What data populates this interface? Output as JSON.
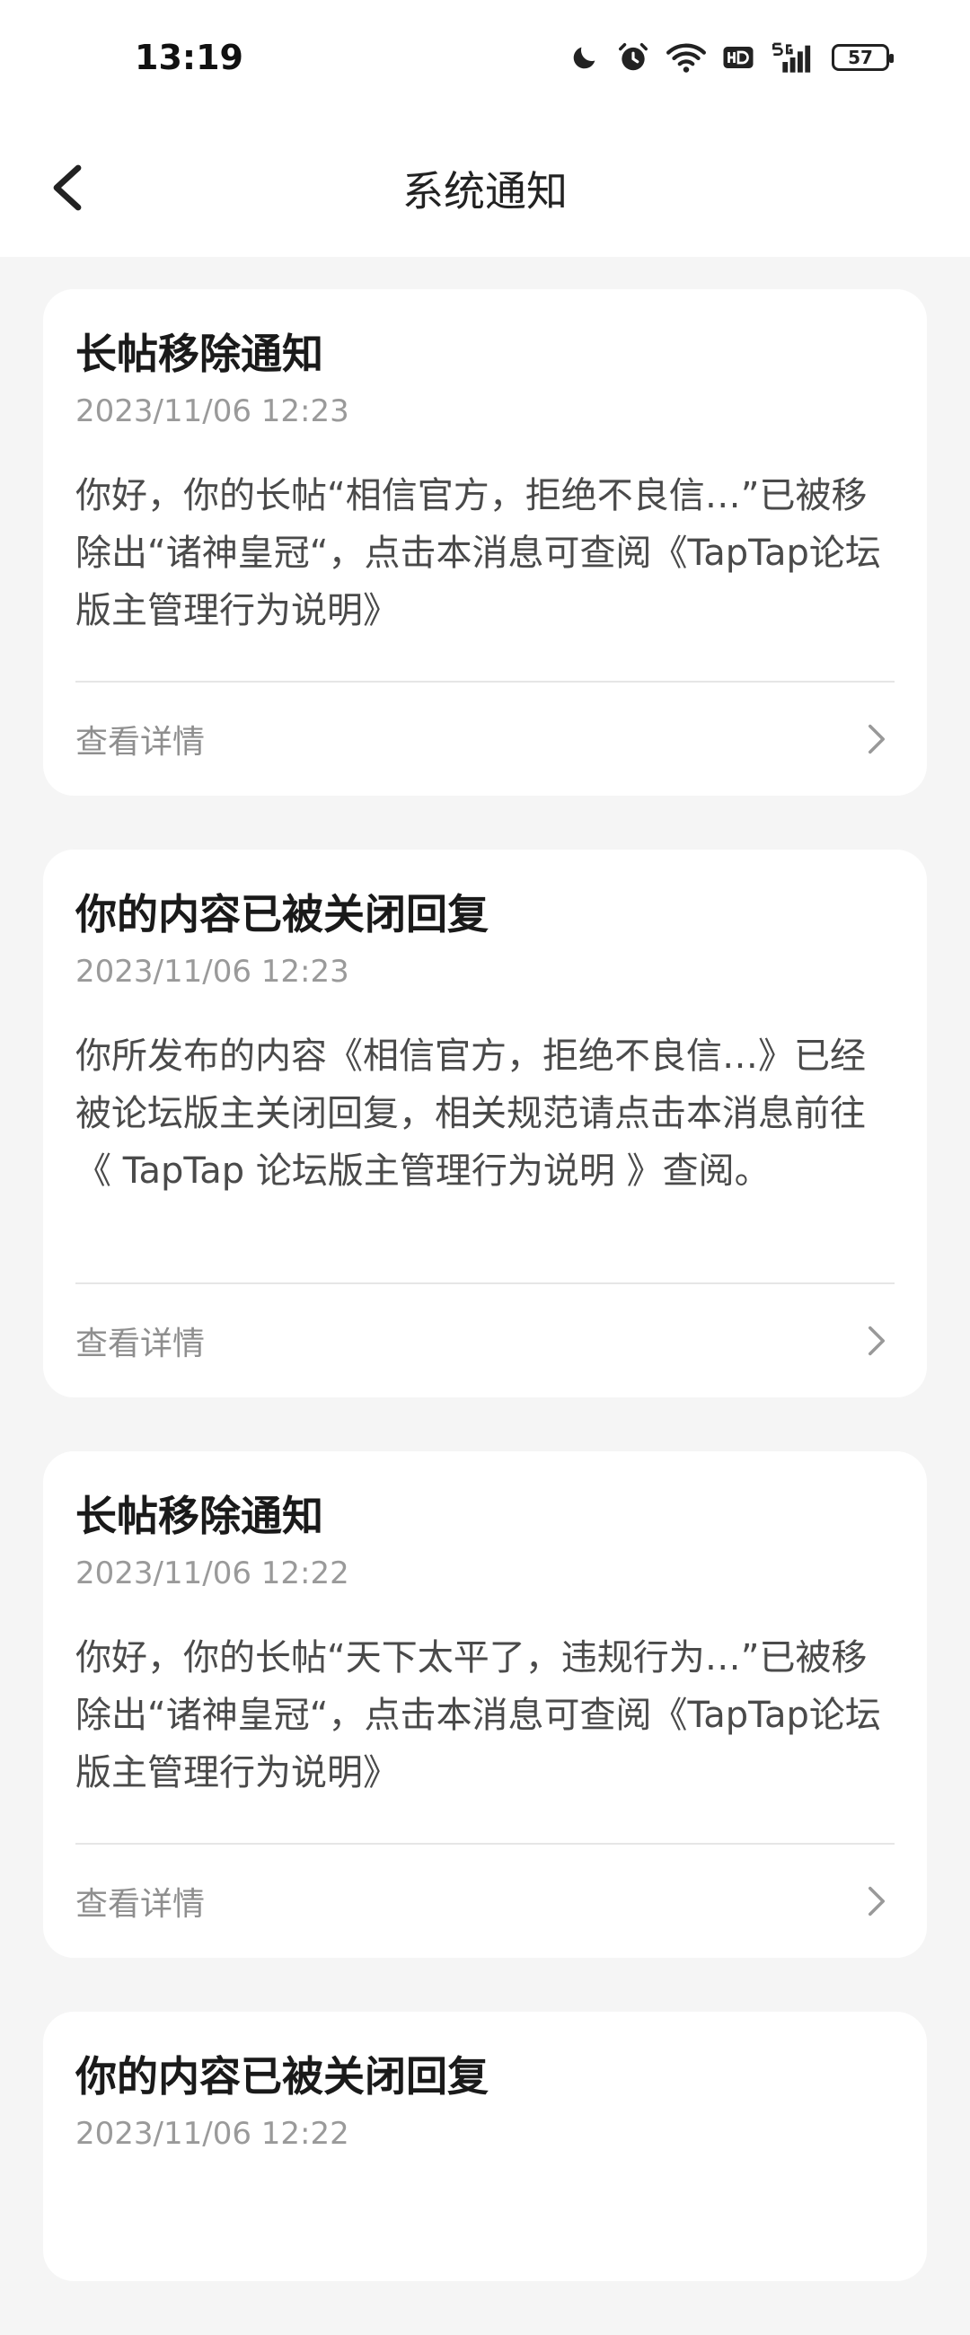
{
  "status_bar": {
    "time": "13:19",
    "battery_level": "57",
    "icons": [
      "moon-icon",
      "alarm-icon",
      "wifi-icon",
      "hd-icon",
      "signal-5g-icon",
      "battery-icon"
    ]
  },
  "header": {
    "title": "系统通知",
    "back_icon": "chevron-left-icon"
  },
  "cards": [
    {
      "title": "长帖移除通知",
      "time": "2023/11/06 12:23",
      "body": "你好，你的长帖“相信官方，拒绝不良信…”已被移除出“诸神皇冠“，点击本消息可查阅《TapTap论坛版主管理行为说明》",
      "detail_label": "查看详情"
    },
    {
      "title": "你的内容已被关闭回复",
      "time": "2023/11/06 12:23",
      "body": "你所发布的内容《相信官方，拒绝不良信…》已经被论坛版主关闭回复，相关规范请点击本消息前往《 TapTap 论坛版主管理行为说明 》查阅。",
      "detail_label": "查看详情"
    },
    {
      "title": "长帖移除通知",
      "time": "2023/11/06 12:22",
      "body": "你好，你的长帖“天下太平了，违规行为…”已被移除出“诸神皇冠“，点击本消息可查阅《TapTap论坛版主管理行为说明》",
      "detail_label": "查看详情"
    },
    {
      "title": "你的内容已被关闭回复",
      "time": "2023/11/06 12:22",
      "body": "",
      "detail_label": ""
    }
  ]
}
